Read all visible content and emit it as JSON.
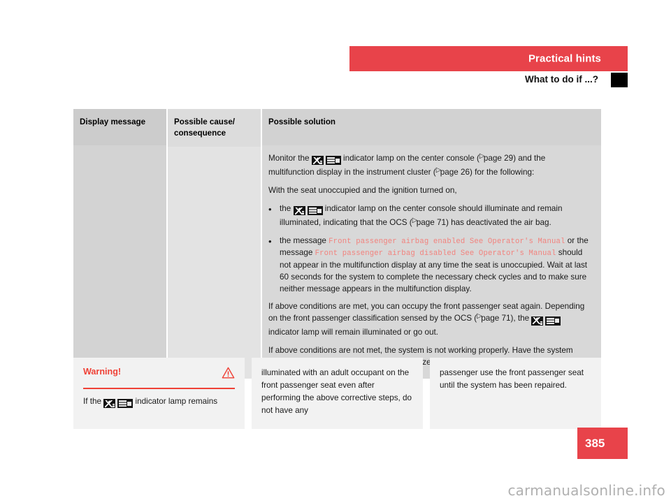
{
  "header": {
    "section_title": "Practical hints",
    "subsection_title": "What to do if ...?",
    "band_color": "#e8434a"
  },
  "table": {
    "columns": [
      {
        "header": "Display message"
      },
      {
        "header": "Possible cause/\nconsequence"
      },
      {
        "header": "Possible solution"
      }
    ],
    "solution": {
      "p1_a": "Monitor the ",
      "p1_b": " indicator lamp on the center console (",
      "p1_page1": "page 29",
      "p1_c": ") and the multifunction display in the instrument cluster (",
      "p1_page2": "page 26",
      "p1_d": ") for the following:",
      "p2": "With the seat unoccupied and the ignition turned on,",
      "bullet1_a": "the ",
      "bullet1_b": " indicator lamp on the center console should illuminate and remain illuminated, indicating that the OCS (",
      "bullet1_page": "page 71",
      "bullet1_c": ") has deactivated the air bag.",
      "bullet2_a": "the message ",
      "bullet2_msg1": "Front passenger airbag enabled See Operator's Manual",
      "bullet2_b": " or the message ",
      "bullet2_msg2": "Front passenger airbag disabled See Operator's Manual",
      "bullet2_c": " should not appear in the multifunction display at any time the seat is unoccupied. Wait at last 60 seconds for the system to complete the necessary check cycles and to make sure neither message appears in the multifunction display.",
      "p3_a": "If above conditions are met, you can occupy the front passenger seat again. Depending on the front passenger classification sensed by the OCS (",
      "p3_page": "page 71",
      "p3_b": "), the ",
      "p3_c": " indicator lamp will remain illuminated or go out.",
      "p4": "If above conditions are not met, the system is not working properly. Have the system checked as soon as possible by an authorized Mercedes-Benz Center."
    }
  },
  "warning": {
    "title": "Warning!",
    "text_a": "If the ",
    "text_b": " indicator lamp remains",
    "continuation_1": "illuminated with an adult occupant on the front passenger seat even after performing the above corrective steps, do not have any",
    "continuation_2": "passenger use the front passenger seat until the system has been repaired.",
    "accent_color": "#ef4136"
  },
  "footer": {
    "page_number": "385",
    "watermark": "carmanualsonline.info"
  }
}
